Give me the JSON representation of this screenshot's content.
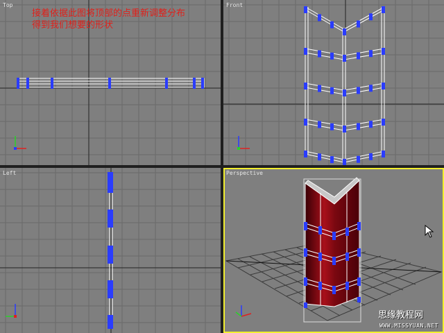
{
  "viewports": {
    "top": {
      "label": "Top"
    },
    "front": {
      "label": "Front"
    },
    "left": {
      "label": "Left"
    },
    "perspective": {
      "label": "Perspective",
      "active": true
    }
  },
  "annotation": {
    "line1": "接着依据此图将顶部的点重新调整分布",
    "line2": "得到我们想要的形状",
    "color": "#e0201a"
  },
  "watermark": {
    "site_name": "思缘教程网",
    "url": "WWW.MISSYUAN.NET"
  },
  "colors": {
    "viewport_bg": "#7f7f7f",
    "active_border": "#f2ef2e",
    "vertex": "#2a3cff",
    "wire": "#ffffff",
    "object_fill": "#8b0a10"
  },
  "icons": {
    "axis_tripod": "axis-tripod-icon",
    "cursor": "mouse-pointer-icon"
  }
}
